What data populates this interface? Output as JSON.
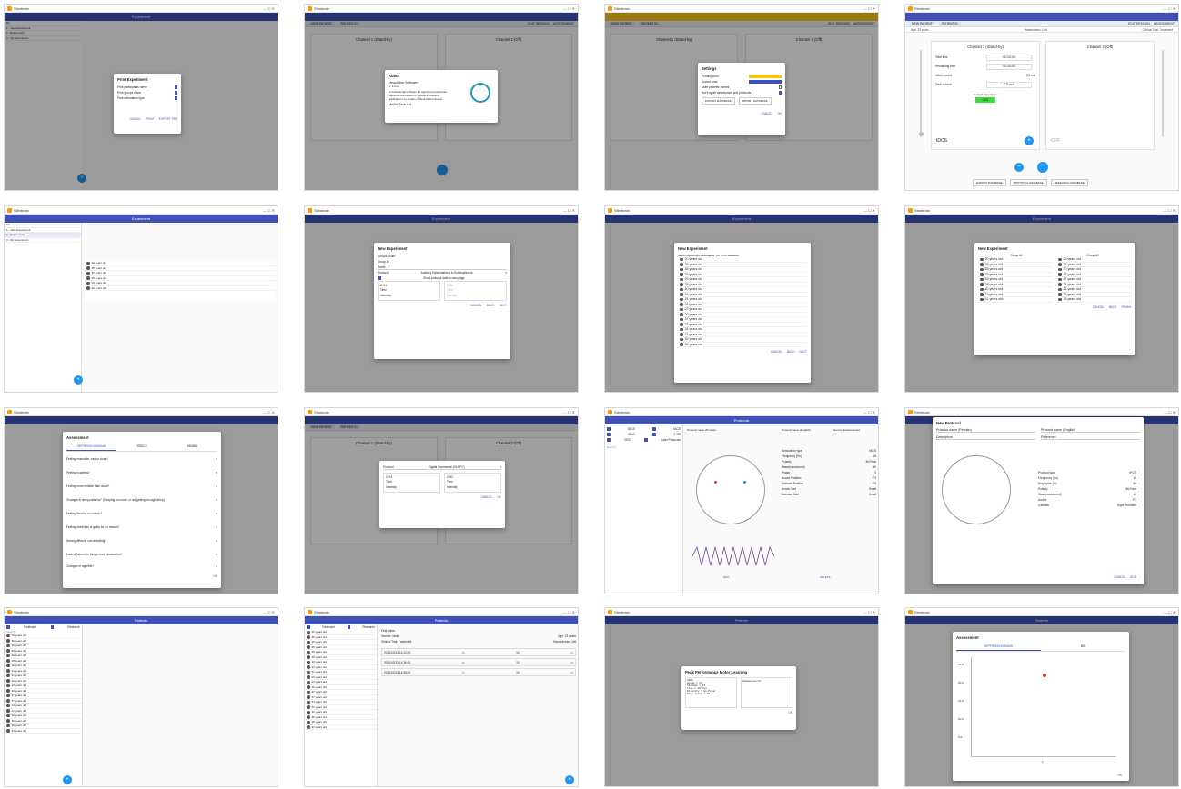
{
  "app": {
    "window_title": "Stimbrain",
    "window_controls": [
      "—",
      "☐",
      "✕"
    ],
    "brand_color": "#3f51b5",
    "accent_color": "#2196f3"
  },
  "common": {
    "toolbar_new_patient": "NEW PATIENT",
    "toolbar_patient_id": "PATIENT ID",
    "toolbar_edit_session": "EDIT SESSION",
    "toolbar_assessment": "ASSESSMENT",
    "info_age": "Age: 23 years",
    "info_handedness": "Handedness: Left",
    "info_clinical": "Clinical Trial: Treatment",
    "channel1_title": "Channel 1 (Stand-by)",
    "channel2_title": "Channel 2 (Off)",
    "total_time_label": "Total time",
    "remaining_time_label": "Remaining time",
    "initial_current_label": "Initial current",
    "total_current_label": "Total current",
    "contact_impedance_label": "Contact Impedance",
    "time_value": "00:10:00",
    "current_value": "0.5 mA",
    "impedance_value": "0 kΩ",
    "ch1_mode": "tDCS",
    "ch2_mode": "OFF",
    "bottom_export": "EXPORT DATABASE",
    "bottom_protocol": "PROTOCOL DATABASE",
    "bottom_research": "RESEARCH DATABASE"
  },
  "tile_print": {
    "title": "Print Experiment",
    "opt1": "Print participants name",
    "opt2": "Print groups name",
    "opt3": "Print stimulation type",
    "cancel": "CANCEL",
    "print": "PRINT",
    "export_pdf": "EXPORT PDF"
  },
  "tile_about": {
    "title": "About",
    "name": "NeuroStim Software",
    "version": "V 1.0.0",
    "desc": "A professional software for applying transcranial Electrical Stimulation in clinical & research applications by means of NeuroStim2 device.",
    "company": "Medial Tech Ltd."
  },
  "tile_settings": {
    "title": "Settings",
    "primary_color": "Primary color",
    "accent_color": "Accent color",
    "mute": "Mute patients' names",
    "set_english": "Set English assessment and protocols",
    "export_db": "EXPORT DATABASE",
    "import_db": "IMPORT DATABASE",
    "cancel": "CANCEL",
    "ok": "OK",
    "swatch_primary": "#f5c518",
    "swatch_accent": "#3f51b5"
  },
  "tile_main": {
    "mode": "tDCS",
    "off": "OFF"
  },
  "tile_experiment": {
    "title": "Experiment",
    "tab_all": "All",
    "item1": "1 - New Experiment",
    "item2": "2 - Experiment",
    "item3": "3 - My Experiment"
  },
  "tile_new_exp1": {
    "title": "New Experiment",
    "groups_count_label": "Groups count",
    "group_label": "Group #1",
    "name_label": "Name",
    "protocol_label": "Protocol",
    "protocol_value": "Auditory Hallucinations in Schizophrenia",
    "show_protocol": "Show protocol data in new page",
    "ch1": "CH1",
    "ch2": "CH2",
    "time_label": "Time",
    "intensity_label": "Intensity",
    "cancel": "CANCEL",
    "back": "BACK",
    "next": "NEXT"
  },
  "tile_new_exp2": {
    "title": "New Experiment",
    "subtitle": "Select experiment participants. (10 of 25 selected)",
    "cancel": "CANCEL",
    "back": "BACK",
    "next": "NEXT"
  },
  "tile_new_exp3": {
    "title": "New Experiment",
    "group1": "Group #1",
    "group2": "Group #2",
    "cancel": "CANCEL",
    "back": "BACK",
    "finish": "FINISH"
  },
  "tile_assessment": {
    "title": "Assessment",
    "tab1": "DEPRESSION/HAMD",
    "tab2": "YBOCS",
    "tab3": "BDI/BAI",
    "q1": "Feeling miserable, sad or down?",
    "q2": "Feeling hopeless?",
    "q3": "Feeling more irritable than usual?",
    "q4": "Changes in sleep patterns? (Sleeping too much or not getting enough sleep)",
    "q5": "Feeling tired for no reason?",
    "q6": "Feeling worthless or guilty for no reason?",
    "q7": "Having difficulty concentrating?",
    "q8": "Loss of interest in things once pleasurable?",
    "q9": "Changes in appetite?",
    "ok": "OK"
  },
  "tile_protocol_dlg": {
    "protocol_label": "Protocol",
    "protocol_value": "Digital Depression (DLPFC)",
    "ch1": "CH1",
    "ch2": "CH2",
    "time": "Time",
    "intensity": "Intensity",
    "cancel": "CANCEL",
    "ok": "OK"
  },
  "tile_protocols": {
    "title": "Protocols",
    "tdcs": "tDCS",
    "tacs": "tACS",
    "trns": "tRNS",
    "tpcs": "tPCS",
    "ces": "CES",
    "user": "User Protocols",
    "search": "Search",
    "protocol_name_label": "Protocol name (Persian)",
    "protocol_name_en": "Protocol name (English)",
    "memory": "Memory Enhancement",
    "stim_type": "Stimulation type",
    "stim_type_value": "tACS",
    "freq_label": "Frequency (Hz)",
    "freq_value": "15",
    "polarity_label": "Polarity",
    "polarity_value": "Bi-Polar",
    "wave_label": "Wave(ms/second)",
    "wave_value": "40",
    "phase_label": "Phase",
    "phase_value": "0",
    "anode_label": "Anode Position",
    "anode_value": "F3",
    "cathode_label": "Cathode Position",
    "cathode_value": "F4",
    "anode_size_label": "Anode Size",
    "anode_size_value": "Small",
    "cathode_size_label": "Cathode Size",
    "cathode_size_value": "Small",
    "edit": "EDIT",
    "delete": "DELETE"
  },
  "tile_new_protocol": {
    "title": "New Protocol",
    "name_fa": "Protocol name (Persian)",
    "name_en": "Protocol name (English)",
    "description": "Description",
    "reference": "Reference",
    "protocol_type": "Protocol type",
    "protocol_type_value": "tPCS",
    "frequency": "Frequency (Hz)",
    "frequency_value": "10",
    "duty": "Duty cycle (%)",
    "duty_value": "50",
    "polarity": "Polarity",
    "polarity_value": "Bi-Polar",
    "wave": "Wave(ms/second)",
    "wave_value": "10",
    "anode": "Anode",
    "anode_value": "F3",
    "cathode": "Cathode",
    "cathode_value": "Right Shoulder",
    "cancel": "CANCEL",
    "add": "ADD"
  },
  "tile_patients": {
    "title": "Patients",
    "treatment": "Treatment",
    "research": "Research",
    "search": "Search"
  },
  "tile_sessions": {
    "title": "Patients",
    "name_label": "First name",
    "gender": "Gender: Male",
    "age": "Age: 23 years",
    "clinical": "Clinical Trial: Treatment",
    "handed": "Handedness: Left",
    "s1_date": "2021/02/23 14:12:00",
    "s2_date": "2021/02/23 14:36:00",
    "s3_date": "2021/02/23 14:38:00",
    "s_time": "10",
    "s_current": "0.5"
  },
  "tile_peak": {
    "title": "Peak Performance Motor Learning",
    "notes_label": "Channel one off",
    "body": "tDCS\nAnode = F3\nCathode = F4\nTime = 20 min\nPolarity = Bi-Polar\nDuty Cycle = 50",
    "ok": "OK"
  },
  "tile_assess_chart": {
    "title": "Assessment",
    "tab1": "DEPRESSION/HAMD",
    "tab2": "BDI",
    "y_ticks": [
      "25.0",
      "20.0",
      "15.0",
      "10.0",
      "5.0"
    ],
    "x_tick": "1",
    "ok": "OK"
  },
  "patients_list": [
    "20 years old",
    "35 years old",
    "35 years old",
    "25 years old",
    "29 years old",
    "28 years old",
    "40 years old",
    "33 years old",
    "31 years old",
    "26 years old",
    "22 years old",
    "30 years old",
    "37 years old",
    "27 years old",
    "24 years old",
    "21 years old",
    "32 years old",
    "36 years old",
    "38 years old",
    "34 years old"
  ]
}
